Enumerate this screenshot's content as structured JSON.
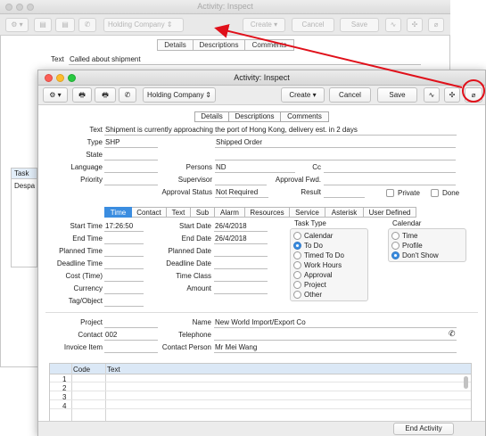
{
  "background_window": {
    "title": "Activity: Inspect",
    "toolbar": {
      "holding_company": "Holding Company",
      "create": "Create",
      "cancel": "Cancel",
      "save": "Save"
    },
    "tabs": [
      "Details",
      "Descriptions",
      "Comments"
    ],
    "text_label": "Text",
    "text_value": "Called about shipment",
    "list_header": "Task",
    "list_item": "Despa"
  },
  "window": {
    "title": "Activity: Inspect",
    "toolbar": {
      "company_select": "Holding Company",
      "create_menu": "Create",
      "cancel_label": "Cancel",
      "save_label": "Save"
    },
    "tabs": [
      "Details",
      "Descriptions",
      "Comments"
    ],
    "header_fields": {
      "text_label": "Text",
      "text_value": "Shipment is currently approaching the port of Hong Kong, delivery est. in 2 days",
      "type_label": "Type",
      "type_value": "SHP",
      "type_desc": "Shipped Order",
      "state_label": "State",
      "language_label": "Language",
      "priority_label": "Priority",
      "persons_label": "Persons",
      "persons_value": "ND",
      "supervisor_label": "Supervisor",
      "approval_status_label": "Approval Status",
      "approval_status_value": "Not Required",
      "cc_label": "Cc",
      "approval_fwd_label": "Approval Fwd.",
      "result_label": "Result",
      "private_label": "Private",
      "done_label": "Done"
    },
    "subtabs": [
      "Time",
      "Contact",
      "Text",
      "Sub",
      "Alarm",
      "Resources",
      "Service",
      "Asterisk",
      "User Defined"
    ],
    "time_tab": {
      "start_time_label": "Start Time",
      "start_time_value": "17:26:50",
      "end_time_label": "End Time",
      "planned_time_label": "Planned Time",
      "deadline_time_label": "Deadline Time",
      "cost_label": "Cost (Time)",
      "currency_label": "Currency",
      "tag_label": "Tag/Object",
      "start_date_label": "Start Date",
      "start_date_value": "26/4/2018",
      "end_date_label": "End Date",
      "end_date_value": "26/4/2018",
      "planned_date_label": "Planned Date",
      "deadline_date_label": "Deadline Date",
      "time_class_label": "Time Class",
      "amount_label": "Amount",
      "task_type_title": "Task Type",
      "task_types": [
        "Calendar",
        "To Do",
        "Timed To Do",
        "Work Hours",
        "Approval",
        "Project",
        "Other"
      ],
      "task_type_selected": "To Do",
      "calendar_title": "Calendar",
      "calendar_options": [
        "Time",
        "Profile",
        "Don't Show"
      ],
      "calendar_selected": "Don't Show"
    },
    "contact_fields": {
      "project_label": "Project",
      "contact_label": "Contact",
      "contact_value": "002",
      "invoice_item_label": "Invoice Item",
      "name_label": "Name",
      "name_value": "New World Import/Export Co",
      "telephone_label": "Telephone",
      "contact_person_label": "Contact Person",
      "contact_person_value": "Mr Mei Wang"
    },
    "grid": {
      "columns": [
        "Code",
        "Text"
      ],
      "rows": [
        "1",
        "2",
        "3",
        "4"
      ]
    },
    "end_activity_label": "End Activity"
  },
  "colors": {
    "accent": "#3b8de0",
    "annotation": "#e0101a",
    "close": "#fc5f57",
    "minimize": "#fdbc2e",
    "zoom": "#28c940"
  }
}
